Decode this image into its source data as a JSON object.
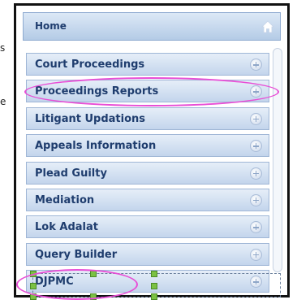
{
  "stray_text": [
    "s",
    "e"
  ],
  "menu": {
    "home_label": "Home",
    "items": [
      {
        "label": "Court Proceedings"
      },
      {
        "label": "Proceedings Reports"
      },
      {
        "label": "Litigant Updations"
      },
      {
        "label": "Appeals Information"
      },
      {
        "label": "Plead Guilty"
      },
      {
        "label": "Mediation"
      },
      {
        "label": "Lok Adalat"
      },
      {
        "label": "Query Builder"
      },
      {
        "label": "DJPMC"
      }
    ]
  },
  "icons": {
    "home": "home-icon",
    "expand": "plus-circle-icon"
  },
  "colors": {
    "highlight": "#e84ed6",
    "menu_text": "#1f3d6e"
  }
}
